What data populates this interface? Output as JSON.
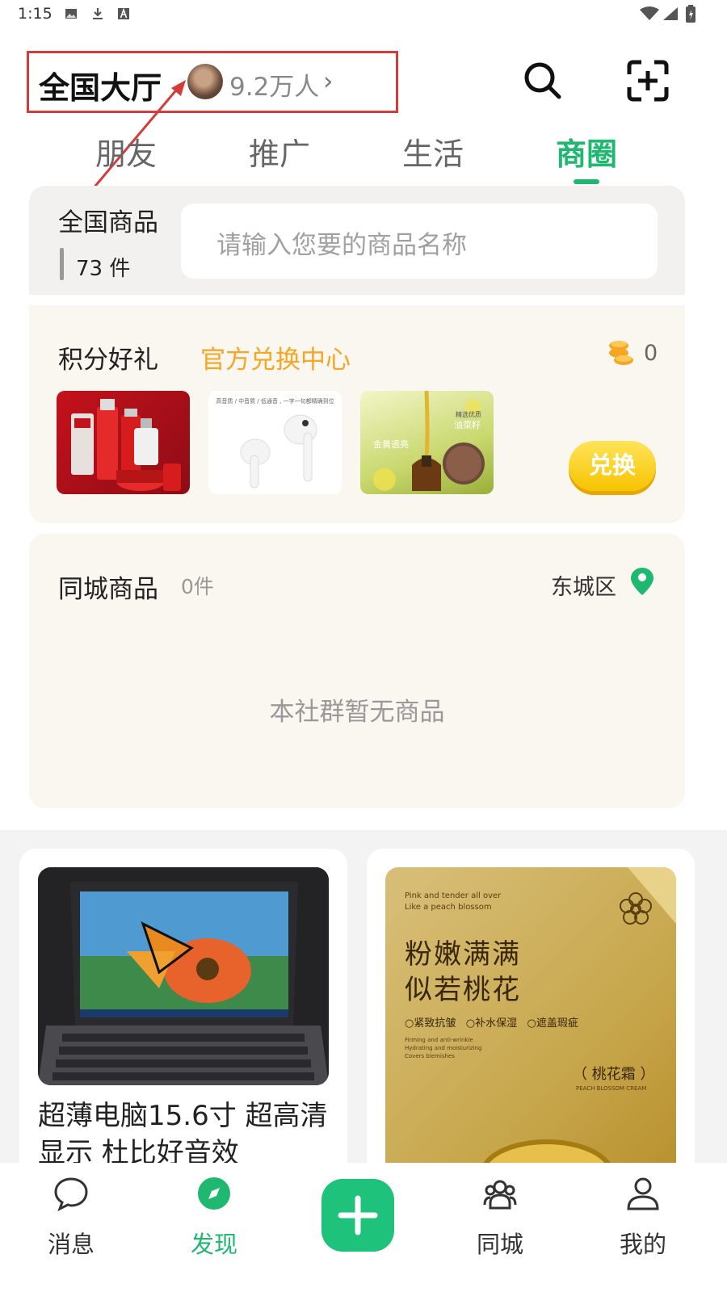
{
  "status": {
    "time": "1:15"
  },
  "header": {
    "title": "全国大厅",
    "member_count": "9.2万人",
    "chevron": "›"
  },
  "tabs": [
    {
      "label": "朋友"
    },
    {
      "label": "推广"
    },
    {
      "label": "生活"
    },
    {
      "label": "商圈",
      "active": true
    }
  ],
  "national": {
    "label": "全国商品",
    "count": "73 件",
    "search_placeholder": "请输入您要的商品名称"
  },
  "points": {
    "label": "积分好礼",
    "subtitle": "官方兑换中心",
    "coins": "0",
    "exchange_label": "兑换",
    "products": [
      {
        "name": "olay-skincare-set"
      },
      {
        "name": "wireless-earbuds",
        "caption": "高音质 / 中音质 / 低通音 , 一字一句都精确到位"
      },
      {
        "name": "rapeseed-oil",
        "caption1": "精选优质",
        "caption2": "油菜籽",
        "caption3": "金黄透亮"
      }
    ]
  },
  "local": {
    "label": "同城商品",
    "count": "0件",
    "district": "东城区",
    "empty_text": "本社群暂无商品"
  },
  "feed": [
    {
      "title": "超薄电脑15.6寸 超高清显示 杜比好音效"
    },
    {
      "poster_en1": "Pink and tender all over",
      "poster_en2": "Like a peach blossom",
      "poster_line1": "粉嫩满满",
      "poster_line2": "似若桃花",
      "poster_tags": "○紧致抗皱   ○补水保湿   ○遮盖瑕疵",
      "poster_en3": "Firming and anti-wrinkle",
      "poster_en4": "Hydrating and moisturizing",
      "poster_en5": "Covers blemishes",
      "poster_product": "（ 桃花霜 ）",
      "poster_product_en": "PEACH BLOSSOM CREAM"
    }
  ],
  "bottom_nav": [
    {
      "label": "消息",
      "icon": "chat-bubble-icon"
    },
    {
      "label": "发现",
      "icon": "compass-icon",
      "active": true
    },
    {
      "label": "同城",
      "icon": "people-icon"
    },
    {
      "label": "我的",
      "icon": "person-icon"
    }
  ],
  "colors": {
    "accent": "#1fb870",
    "orange": "#f5a623",
    "annotation": "#d63b3b"
  }
}
